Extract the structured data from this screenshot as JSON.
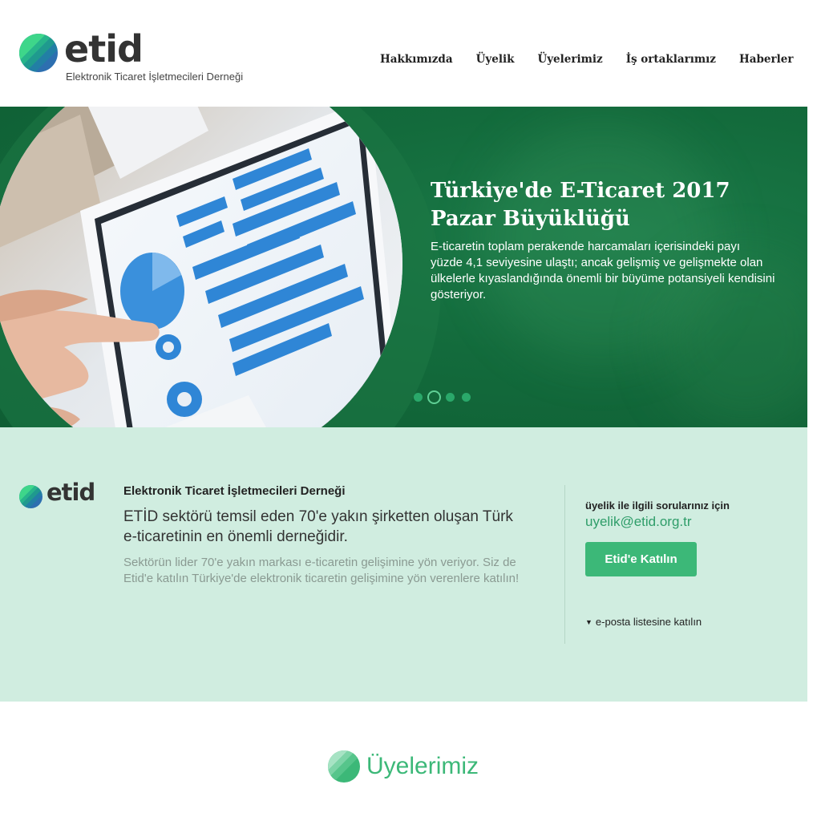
{
  "brand": {
    "name": "etid",
    "subtitle": "Elektronik Ticaret İşletmecileri Derneği",
    "colors": {
      "green": "#3cb878",
      "teal": "#1f9a7a",
      "blue": "#2d6fb0",
      "dark_green": "#136b3c"
    }
  },
  "nav": {
    "items": [
      {
        "label": "Hakkımızda"
      },
      {
        "label": "Üyelik"
      },
      {
        "label": "Üyelerimiz"
      },
      {
        "label": "İş ortaklarımız"
      },
      {
        "label": "Haberler"
      }
    ]
  },
  "hero": {
    "title": "Türkiye'de E-Ticaret 2017 Pazar Büyüklüğü",
    "text": "E-ticaretin toplam perakende harcamaları içerisindeki payı yüzde 4,1 seviyesine ulaştı; ancak gelişmiş ve gelişmekte olan ülkelerle kıyaslandığında önemli bir büyüme potansiyeli kendisini gösteriyor.",
    "slide_count": 4,
    "active_slide": 2
  },
  "info": {
    "org_name": "Elektronik Ticaret İşletmecileri Derneği",
    "lead": "ETİD sektörü temsil eden 70'e yakın şirketten oluşan Türk e-ticaretinin en önemli derneğidir.",
    "description": "Sektörün lider 70'e yakın markası e-ticaretin gelişimine yön veriyor. Siz de Etid'e katılın Türkiye'de elektronik ticaretin gelişimine yön verenlere katılın!",
    "membership_question": "üyelik ile ilgili sorularınız için",
    "membership_email": "uyelik@etid.org.tr",
    "join_button": "Etid'e Katılın",
    "mailing_list": "e-posta listesine katılın"
  },
  "members": {
    "title": "Üyelerimiz"
  }
}
